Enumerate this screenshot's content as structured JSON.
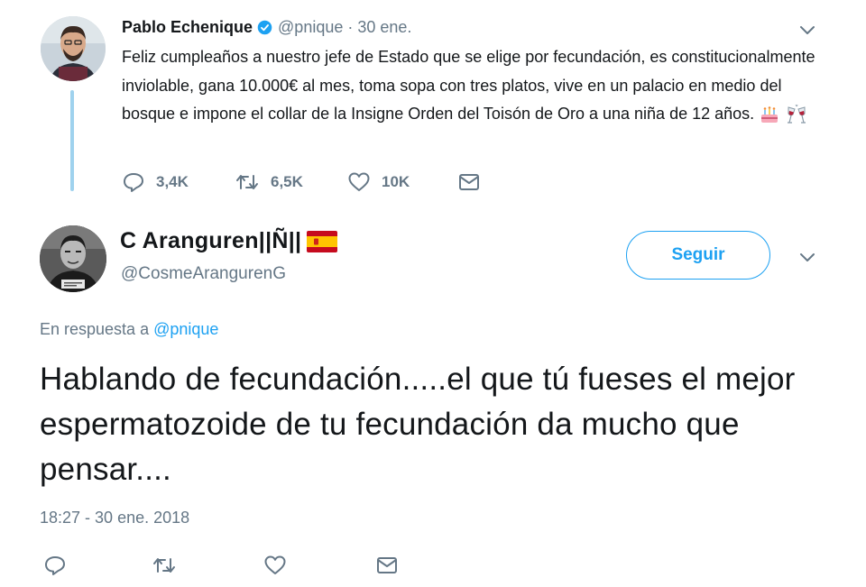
{
  "parent_tweet": {
    "name": "Pablo Echenique",
    "handle": "@pnique",
    "separator": "·",
    "date": "30 ene.",
    "text": "Feliz cumpleaños a nuestro jefe de Estado que se elige por fecundación, es constitucionalmente inviolable, gana 10.000€ al mes, toma sopa con tres platos, vive en un palacio en medio del bosque e impone el collar de la Insigne Orden del Toisón de Oro a una niña de 12 años.",
    "emojis": [
      "cake-icon",
      "clinking-glasses-icon"
    ],
    "actions": {
      "reply_count": "3,4K",
      "retweet_count": "6,5K",
      "like_count": "10K"
    }
  },
  "reply_tweet": {
    "name": "C Aranguren||Ñ||",
    "flag": "spain-flag-icon",
    "handle": "@CosmeArangurenG",
    "follow_label": "Seguir",
    "in_reply_prefix": "En respuesta a",
    "in_reply_mention": "@pnique",
    "text": "Hablando de fecundación.....el que tú fueses el mejor espermatozoide de tu fecundación da mucho que pensar....",
    "timestamp": "18:27 - 30 ene. 2018"
  },
  "colors": {
    "accent": "#1da1f2",
    "muted": "#657786",
    "text": "#14171a",
    "thread_line": "#9fd2ee"
  }
}
